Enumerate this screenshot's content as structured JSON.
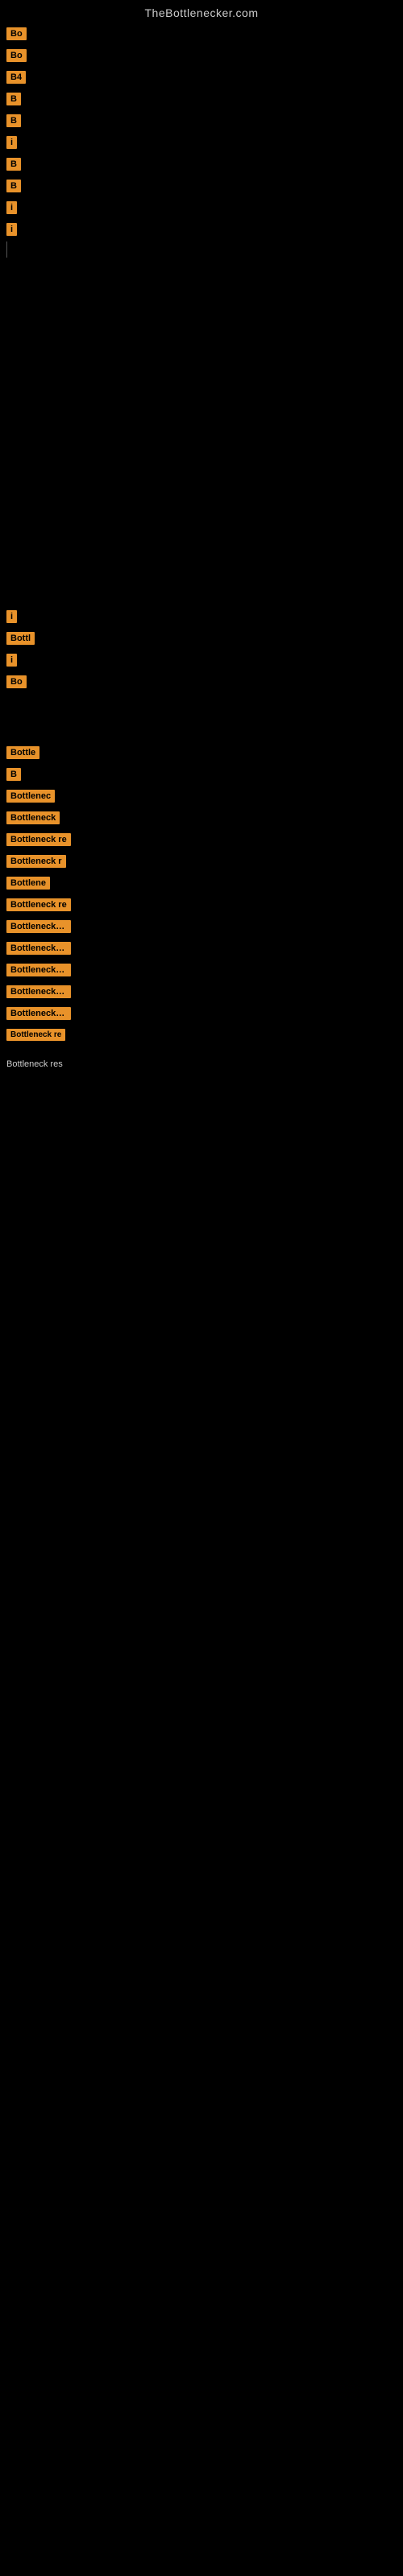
{
  "site": {
    "title": "TheBottlenecker.com"
  },
  "rows": [
    {
      "badge": "Bo",
      "label": ""
    },
    {
      "badge": "Bo",
      "label": ""
    },
    {
      "badge": "B4",
      "label": ""
    },
    {
      "badge": "B",
      "label": ""
    },
    {
      "badge": "B",
      "label": ""
    },
    {
      "badge": "i",
      "label": ""
    },
    {
      "badge": "B",
      "label": ""
    },
    {
      "badge": "B",
      "label": ""
    },
    {
      "badge": "i",
      "label": ""
    },
    {
      "badge": "i",
      "label": ""
    },
    {
      "badge": "",
      "label": ""
    },
    {
      "badge": "",
      "label": ""
    },
    {
      "badge": "",
      "label": ""
    },
    {
      "badge": "",
      "label": ""
    },
    {
      "badge": "",
      "label": ""
    },
    {
      "badge": "",
      "label": ""
    },
    {
      "badge": "",
      "label": ""
    },
    {
      "badge": "",
      "label": ""
    },
    {
      "badge": "",
      "label": ""
    },
    {
      "badge": "",
      "label": ""
    },
    {
      "badge": "",
      "label": ""
    },
    {
      "badge": "i",
      "label": ""
    },
    {
      "badge": "Bottl",
      "label": ""
    },
    {
      "badge": "i",
      "label": ""
    },
    {
      "badge": "Bo",
      "label": ""
    },
    {
      "badge": "",
      "label": ""
    },
    {
      "badge": "",
      "label": ""
    },
    {
      "badge": "Bottle",
      "label": ""
    },
    {
      "badge": "B",
      "label": ""
    },
    {
      "badge": "Bottlenec",
      "label": ""
    },
    {
      "badge": "Bottleneck",
      "label": ""
    },
    {
      "badge": "Bottleneck re",
      "label": ""
    },
    {
      "badge": "Bottleneck r",
      "label": ""
    },
    {
      "badge": "Bottlene",
      "label": ""
    },
    {
      "badge": "Bottleneck re",
      "label": ""
    },
    {
      "badge": "Bottleneck resu",
      "label": ""
    },
    {
      "badge": "Bottleneck resu",
      "label": ""
    },
    {
      "badge": "Bottleneck resu",
      "label": ""
    },
    {
      "badge": "Bottleneck resu",
      "label": ""
    },
    {
      "badge": "Bottleneck resu",
      "label": ""
    },
    {
      "badge": "Bottleneck re",
      "label": ""
    }
  ]
}
